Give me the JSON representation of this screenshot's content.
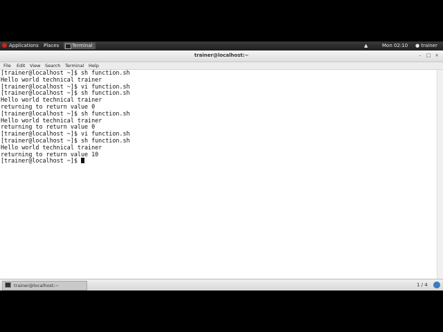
{
  "topbar": {
    "applications": "Applications",
    "places": "Places",
    "taskbar_item": "Terminal",
    "clock": "Mon 02:10",
    "user": "trainer"
  },
  "window": {
    "title": "trainer@localhost:~",
    "menu": [
      "File",
      "Edit",
      "View",
      "Search",
      "Terminal",
      "Help"
    ]
  },
  "terminal": {
    "lines": [
      "[trainer@localhost ~]$ sh function.sh",
      "Hello world technical trainer",
      "[trainer@localhost ~]$ vi function.sh",
      "[trainer@localhost ~]$ sh function.sh",
      "Hello world technical trainer",
      "returning to return value 0",
      "[trainer@localhost ~]$ sh function.sh",
      "Hello world technical trainer",
      "returning to return value 0",
      "[trainer@localhost ~]$ vi function.sh",
      "[trainer@localhost ~]$ sh function.sh",
      "Hello world technical trainer",
      "returning to return value 10"
    ],
    "prompt": "[trainer@localhost ~]$ "
  },
  "bottombar": {
    "task_label": "trainer@localhost:~",
    "workspace": "1 / 4"
  },
  "colors": {
    "topbar": "#2a2a2a",
    "terminal_bg": "#ffffff",
    "notification": "#3b7bc4"
  }
}
